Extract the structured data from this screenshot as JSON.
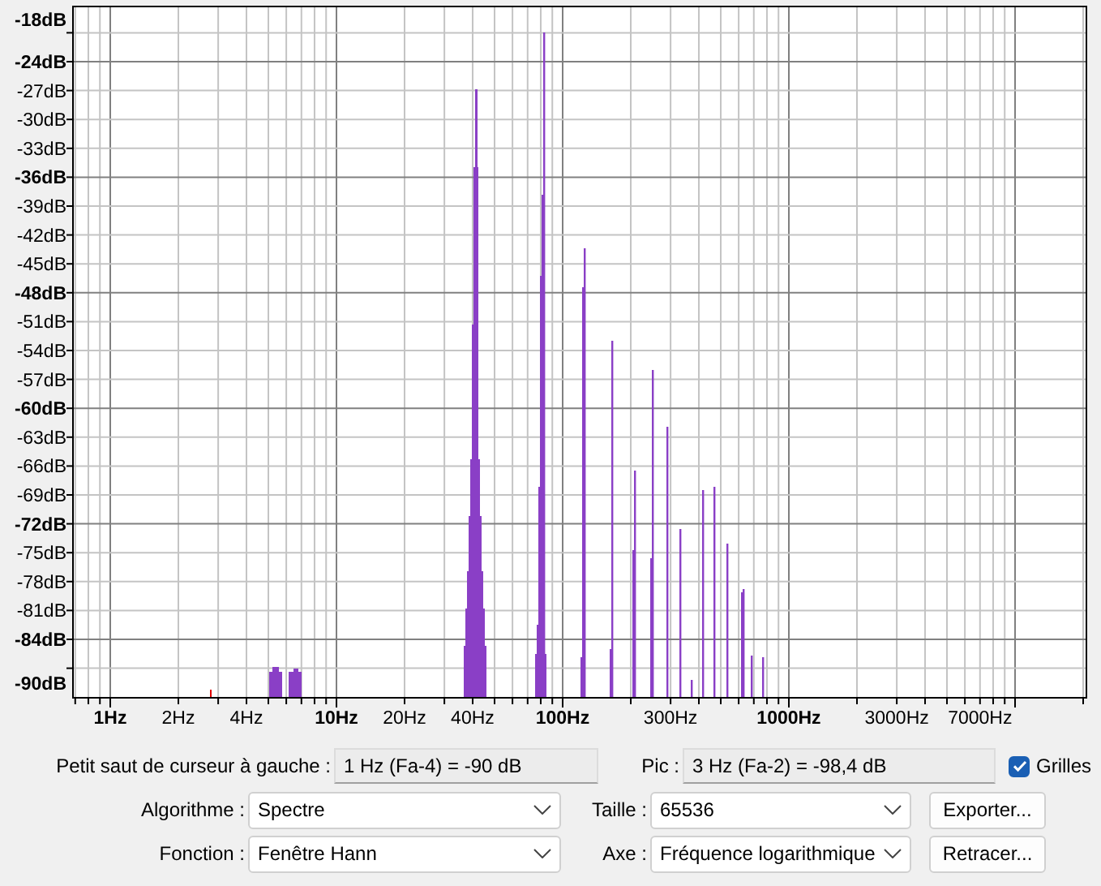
{
  "plot": {
    "y_labels": [
      {
        "text": "-18dB",
        "major": true
      },
      {
        "text": "-24dB",
        "major": true
      },
      {
        "text": "-27dB",
        "major": false
      },
      {
        "text": "-30dB",
        "major": false
      },
      {
        "text": "-33dB",
        "major": false
      },
      {
        "text": "-36dB",
        "major": true
      },
      {
        "text": "-39dB",
        "major": false
      },
      {
        "text": "-42dB",
        "major": false
      },
      {
        "text": "-45dB",
        "major": false
      },
      {
        "text": "-48dB",
        "major": true
      },
      {
        "text": "-51dB",
        "major": false
      },
      {
        "text": "-54dB",
        "major": false
      },
      {
        "text": "-57dB",
        "major": false
      },
      {
        "text": "-60dB",
        "major": true
      },
      {
        "text": "-63dB",
        "major": false
      },
      {
        "text": "-66dB",
        "major": false
      },
      {
        "text": "-69dB",
        "major": false
      },
      {
        "text": "-72dB",
        "major": true
      },
      {
        "text": "-75dB",
        "major": false
      },
      {
        "text": "-78dB",
        "major": false
      },
      {
        "text": "-81dB",
        "major": false
      },
      {
        "text": "-84dB",
        "major": true
      },
      {
        "text": "-90dB",
        "major": true
      }
    ],
    "x_labels": [
      {
        "text": "1Hz",
        "major": true
      },
      {
        "text": "2Hz",
        "major": false
      },
      {
        "text": "4Hz",
        "major": false
      },
      {
        "text": "10Hz",
        "major": true
      },
      {
        "text": "20Hz",
        "major": false
      },
      {
        "text": "40Hz",
        "major": false
      },
      {
        "text": "100Hz",
        "major": true
      },
      {
        "text": "300Hz",
        "major": false
      },
      {
        "text": "1000Hz",
        "major": true
      },
      {
        "text": "3000Hz",
        "major": false
      },
      {
        "text": "7000Hz",
        "major": false
      }
    ]
  },
  "cursor": {
    "label": "Petit saut de curseur à gauche :",
    "value": "1 Hz (Fa-4) = -90 dB"
  },
  "peak": {
    "label": "Pic :",
    "value": "3 Hz (Fa-2) = -98,4 dB"
  },
  "grids": {
    "label": "Grilles",
    "checked": true
  },
  "settings": [
    {
      "left_label": "Algorithme :",
      "left_value": "Spectre",
      "right_label": "Taille :",
      "right_value": "65536",
      "button": "Exporter..."
    },
    {
      "left_label": "Fonction :",
      "left_value": "Fenêtre Hann",
      "right_label": "Axe :",
      "right_value": "Fréquence logarithmique",
      "button": "Retracer..."
    }
  ]
}
